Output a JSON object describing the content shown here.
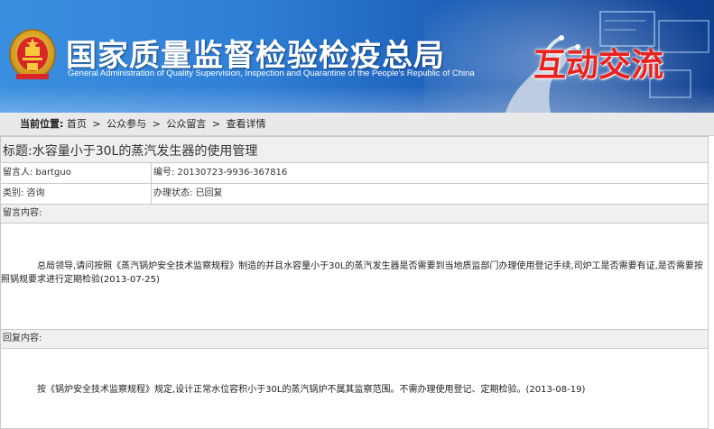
{
  "header": {
    "site_title": "国家质量监督检验检疫总局",
    "site_subtitle": "General Administration of Quality Supervision, Inspection and Quarantine of the People's Republic of China",
    "section_title": "互动交流",
    "colors": {
      "banner_start": "#3a8fe0",
      "banner_end": "#0f3f8f",
      "section_title": "#e8231f"
    }
  },
  "breadcrumb": {
    "lead": "当前位置:",
    "items": [
      "首页",
      "公众参与",
      "公众留言",
      "查看详情"
    ],
    "separator": ">"
  },
  "message": {
    "title": "标题:水容量小于30L的蒸汽发生器的使用管理",
    "author": "留言人: bartguo",
    "number": "编号: 20130723-9936-367816",
    "category": "类别: 咨询",
    "status": "办理状态: 已回复",
    "content_label": "留言内容:",
    "content": "总局领导,请问按照《蒸汽锅炉安全技术监察规程》制造的并且水容量小于30L的蒸汽发生器是否需要到当地质监部门办理使用登记手续,司炉工是否需要有证,是否需要按照锅规要求进行定期检验(2013-07-25)",
    "reply_label": "回复内容:",
    "reply": "按《锅炉安全技术监察规程》规定,设计正常水位容积小于30L的蒸汽锅炉不属其监察范围。不需办理使用登记、定期检验。(2013-08-19)"
  }
}
